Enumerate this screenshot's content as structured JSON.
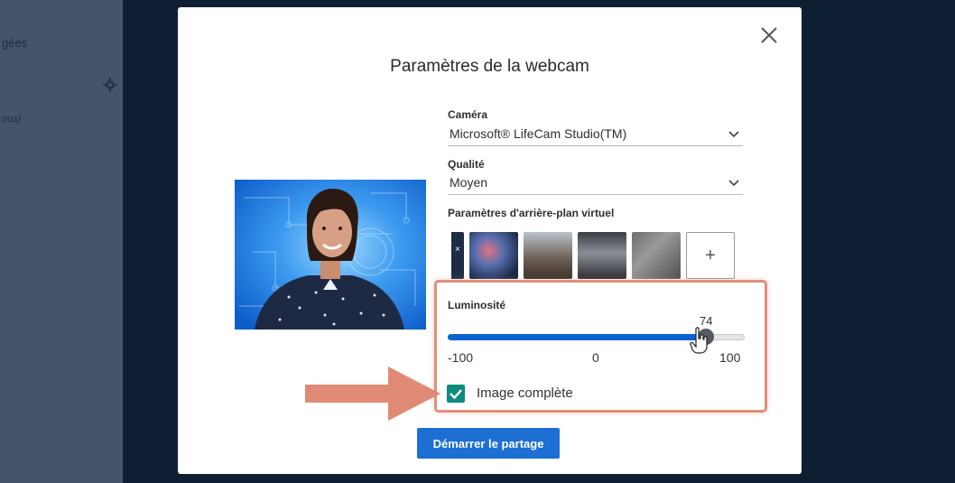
{
  "background": {
    "fragments": [
      "gées",
      "ous)"
    ]
  },
  "modal": {
    "title": "Paramètres de la webcam",
    "camera": {
      "label": "Caméra",
      "value": "Microsoft® LifeCam Studio(TM)"
    },
    "quality": {
      "label": "Qualité",
      "value": "Moyen"
    },
    "virtual_bg": {
      "label": "Paramètres d'arrière-plan virtuel",
      "thumbnails": [
        "no-background",
        "blurred-lights",
        "office-room",
        "meeting-room",
        "gray-texture"
      ],
      "add_label": "+"
    },
    "brightness": {
      "label": "Luminosité",
      "value": "74",
      "min_label": "-100",
      "mid_label": "0",
      "max_label": "100",
      "min": -100,
      "max": 100,
      "current": 74
    },
    "full_image": {
      "label": "Image complète",
      "checked": true
    },
    "start_button": "Démarrer le partage"
  },
  "colors": {
    "accent": "#1d6fd3",
    "slider_fill": "#0b62d3",
    "checkbox": "#0f8a7e",
    "highlight": "#e08f7b"
  },
  "icons": [
    "close-icon",
    "chevron-down-icon",
    "gear-icon",
    "checkmark-icon",
    "hand-cursor-icon",
    "arrow-pointer-icon"
  ]
}
